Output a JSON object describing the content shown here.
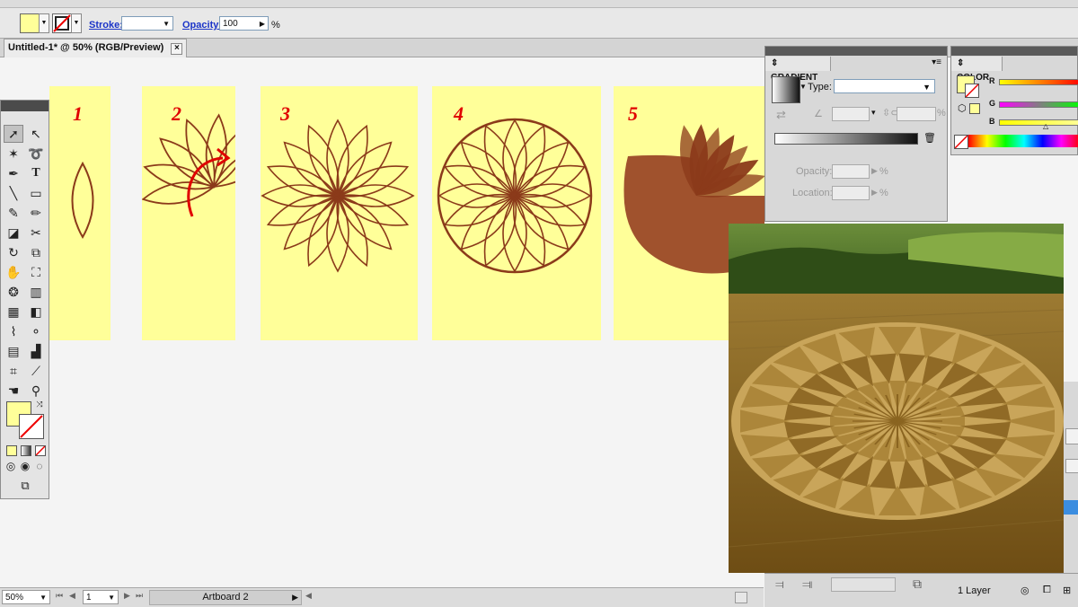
{
  "control_bar": {
    "stroke_label": "Stroke:",
    "opacity_label": "Opacity:",
    "opacity_value": "100",
    "opacity_unit": "%",
    "fill_color": "#ffff99"
  },
  "document": {
    "tab_title": "Untitled-1* @ 50% (RGB/Preview)",
    "close_glyph": "×"
  },
  "artboards": [
    {
      "number": "1"
    },
    {
      "number": "2"
    },
    {
      "number": "3"
    },
    {
      "number": "4"
    },
    {
      "number": "5"
    }
  ],
  "colors": {
    "artboard": "#ffff99",
    "stroke": "#8b3a1a",
    "fill_shape": "#a0522d",
    "number": "#e00000",
    "arrow": "#e00000"
  },
  "gradient_panel": {
    "title": "GRADIENT",
    "type_label": "Type:",
    "opacity_label": "Opacity:",
    "location_label": "Location:",
    "percent": "%"
  },
  "color_panel": {
    "title": "COLOR",
    "channels": [
      "R",
      "G",
      "B"
    ]
  },
  "status_bar": {
    "zoom": "50%",
    "artboard_number": "1",
    "artboard_name": "Artboard 2"
  },
  "layers_bar": {
    "layer_count": "1 Layer"
  }
}
